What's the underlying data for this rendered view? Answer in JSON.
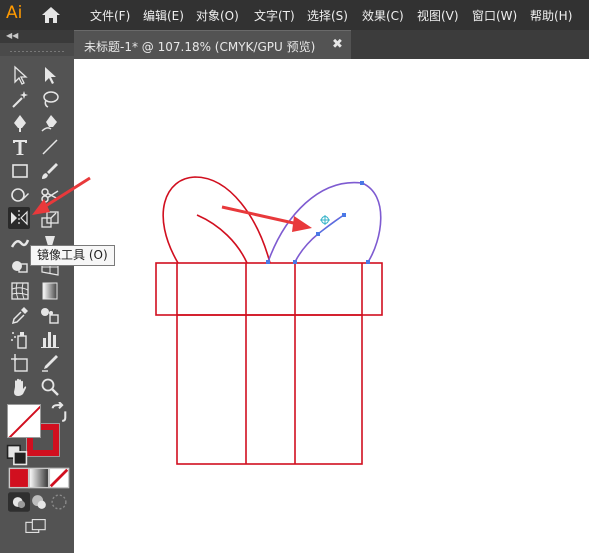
{
  "app": {
    "logo_text": "Ai",
    "menu": [
      "文件(F)",
      "编辑(E)",
      "对象(O)",
      "文字(T)",
      "选择(S)",
      "效果(C)",
      "视图(V)",
      "窗口(W)",
      "帮助(H)"
    ]
  },
  "document_tab": {
    "title": "未标题-1* @ 107.18% (CMYK/GPU 预览)",
    "close_glyph": "✖"
  },
  "tooltip": {
    "text": "镜像工具 (O)"
  },
  "tools": [
    "selection-tool",
    "direct-selection-tool",
    "magic-wand-tool",
    "lasso-tool",
    "pen-tool",
    "curvature-tool",
    "type-tool",
    "line-segment-tool",
    "rectangle-tool",
    "paintbrush-tool",
    "shaper-tool",
    "scissors-tool",
    "reflect-tool",
    "scale-tool",
    "width-tool",
    "free-transform-tool",
    "shape-builder-tool",
    "perspective-grid-tool",
    "mesh-tool",
    "gradient-tool",
    "eyedropper-tool",
    "blend-tool",
    "symbol-sprayer-tool",
    "column-graph-tool",
    "artboard-tool",
    "slice-tool",
    "hand-tool",
    "zoom-tool"
  ],
  "colors": {
    "accent_logo": "#ff9a00",
    "stroke_red": "#d10f1f",
    "selected_path": "#7e5bd1",
    "anchor_blue": "#4a78e6",
    "arrow_red": "#e8393b"
  },
  "swatches": {
    "fill": "none",
    "stroke": "#d10f1f"
  }
}
